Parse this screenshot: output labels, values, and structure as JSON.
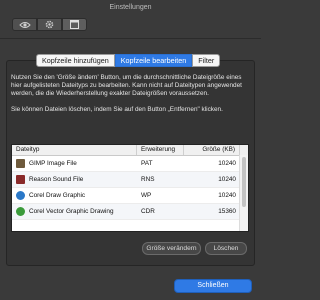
{
  "window": {
    "title": "Einstellungen"
  },
  "toolbar": {
    "icons": [
      "eye-icon",
      "gear-icon",
      "window-icon"
    ]
  },
  "tabs": [
    {
      "label": "Kopfzeile hinzufügen",
      "active": false
    },
    {
      "label": "Kopfzeile bearbeiten",
      "active": true
    },
    {
      "label": "Filter",
      "active": false
    }
  ],
  "description": {
    "p1": "Nutzen Sie den 'Größe ändern' Button, um die durchschnittliche Dateigröße eines hier aufgelisteten Dateityps zu bearbeiten. Kann nicht auf Dateitypen angewendet werden, die die Wiederherstellung exakter Dateigrößen voraussetzen.",
    "p2": "Sie können Dateien löschen, indem Sie auf den Button „Entfernen\" klicken."
  },
  "table": {
    "headers": {
      "type": "Dateityp",
      "ext": "Erweiterung",
      "size": "Größe (KB)"
    },
    "rows": [
      {
        "name": "GIMP Image File",
        "ext": "PAT",
        "size": "10240",
        "icon_color": "#6e5a3c"
      },
      {
        "name": "Reason Sound File",
        "ext": "RNS",
        "size": "10240",
        "icon_color": "#8a2a2a"
      },
      {
        "name": "Corel Draw Graphic",
        "ext": "WP",
        "size": "10240",
        "icon_color": "#2a78c8"
      },
      {
        "name": "Corel Vector Graphic Drawing",
        "ext": "CDR",
        "size": "15360",
        "icon_color": "#3b9b3b"
      }
    ]
  },
  "buttons": {
    "resize": "Größe verändern",
    "delete": "Löschen",
    "close": "Schließen"
  },
  "colors": {
    "accent": "#2f7ae5",
    "background": "#3a3a3a"
  }
}
